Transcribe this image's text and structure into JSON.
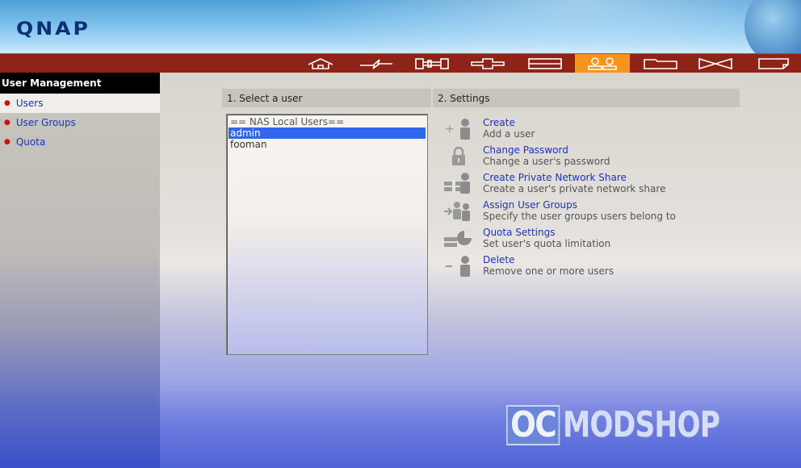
{
  "brand": {
    "logo_text": "QNAP"
  },
  "navbar": {
    "items": [
      {
        "icon": "home-icon"
      },
      {
        "icon": "network-icon"
      },
      {
        "icon": "key-icon"
      },
      {
        "icon": "plus-device-icon"
      },
      {
        "icon": "disk-icon"
      },
      {
        "icon": "users-icon",
        "active": true
      },
      {
        "icon": "folder-icon"
      },
      {
        "icon": "bowtie-icon"
      },
      {
        "icon": "note-icon"
      }
    ],
    "active_color": "#f7941d",
    "bar_color": "#8e2418"
  },
  "sidebar": {
    "title": "User Management",
    "items": [
      {
        "label": "Users",
        "selected": true
      },
      {
        "label": "User Groups"
      },
      {
        "label": "Quota"
      }
    ]
  },
  "main": {
    "select_header": "1. Select a user",
    "settings_header": "2. Settings",
    "user_list": {
      "group_label": "== NAS Local Users==",
      "users": [
        "admin",
        "fooman"
      ],
      "selected": "admin"
    },
    "actions": [
      {
        "title": "Create",
        "desc": "Add a user",
        "icon": "add-user-icon"
      },
      {
        "title": "Change Password",
        "desc": "Change a user's password",
        "icon": "lock-icon"
      },
      {
        "title": "Create Private Network Share",
        "desc": "Create a user's private network share",
        "icon": "network-share-icon"
      },
      {
        "title": "Assign User Groups",
        "desc": "Specify the user groups users belong to",
        "icon": "assign-group-icon"
      },
      {
        "title": "Quota Settings",
        "desc": "Set user's quota limitation",
        "icon": "quota-icon"
      },
      {
        "title": "Delete",
        "desc": "Remove one or more users",
        "icon": "delete-user-icon"
      }
    ]
  },
  "watermark": {
    "part1": "OC",
    "part2": "MODSHOP"
  }
}
